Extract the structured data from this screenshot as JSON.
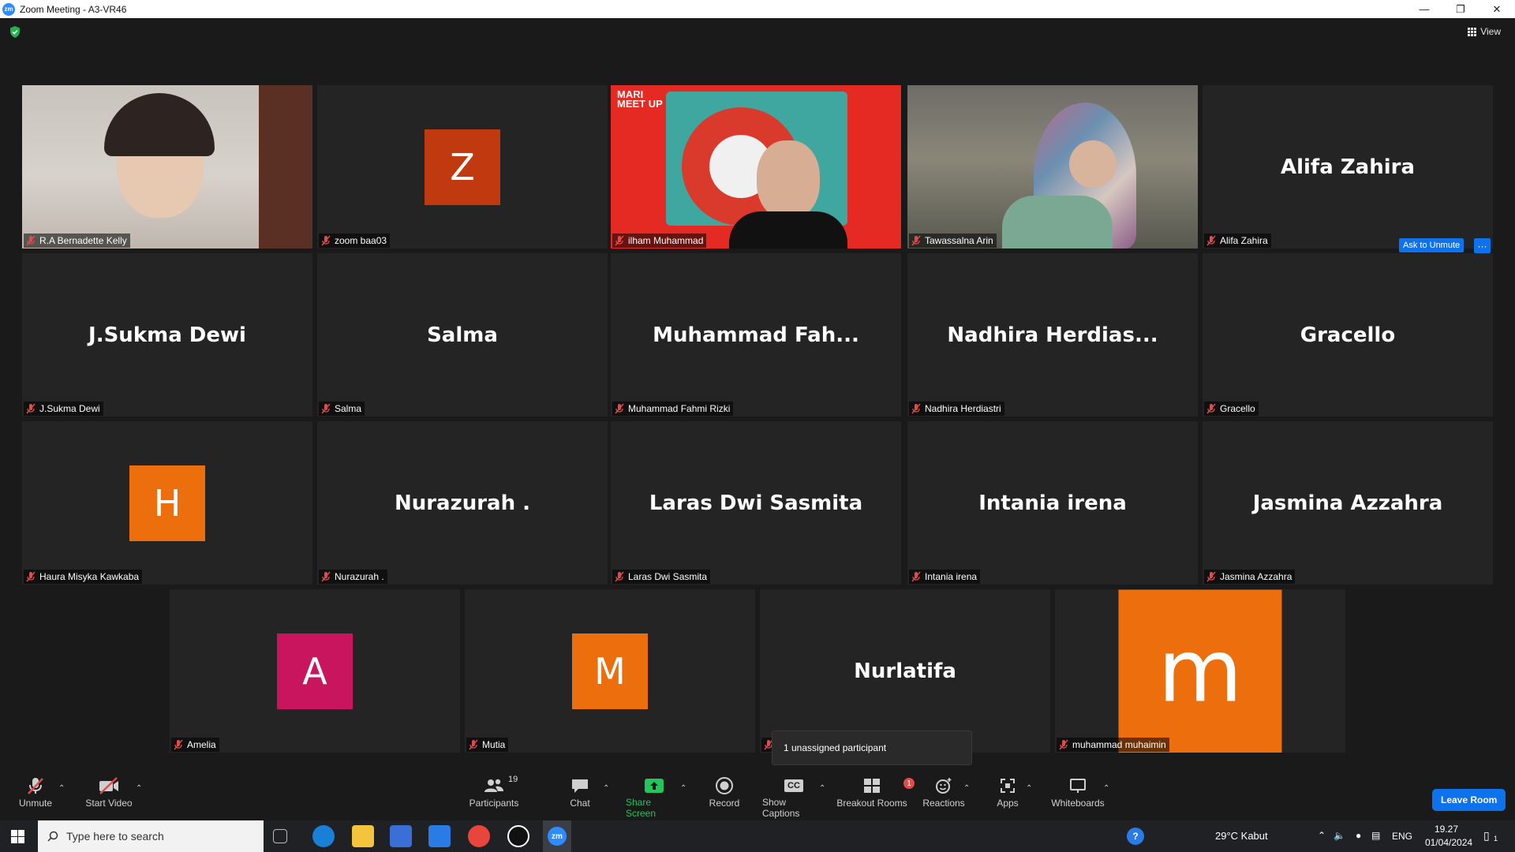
{
  "window": {
    "title": "Zoom Meeting - A3-VR46",
    "app_icon": "zm"
  },
  "meeting": {
    "view_label": "View",
    "ask_to_unmute": "Ask to Unmute",
    "more_glyph": "···",
    "unassigned_text": "1 unassigned participant"
  },
  "tiles": [
    {
      "label": "R.A Bernadette Kelly",
      "type": "video"
    },
    {
      "label": "zoom baa03",
      "initial": "Z",
      "color": "#c0390f"
    },
    {
      "label": "ilham Muhammad",
      "type": "video",
      "active": true
    },
    {
      "label": "Tawassalna Arin",
      "type": "video"
    },
    {
      "label": "Alifa Zahira",
      "display": "Alifa Zahira"
    },
    {
      "label": "J.Sukma Dewi",
      "display": "J.Sukma Dewi"
    },
    {
      "label": "Salma",
      "display": "Salma"
    },
    {
      "label": "Muhammad Fahmi Rizki",
      "display": "Muhammad  Fah..."
    },
    {
      "label": "Nadhira Herdiastri",
      "display": "Nadhira  Herdias..."
    },
    {
      "label": "Gracello",
      "display": "Gracello"
    },
    {
      "label": "Haura Misyka Kawkaba",
      "initial": "H",
      "color": "#ec6e0c"
    },
    {
      "label": "Nurazurah .",
      "display": "Nurazurah ."
    },
    {
      "label": "Laras Dwi Sasmita",
      "display": "Laras Dwi Sasmita"
    },
    {
      "label": "Intania irena",
      "display": "Intania irena"
    },
    {
      "label": "Jasmina Azzahra",
      "display": "Jasmina Azzahra"
    },
    {
      "label": "Amelia",
      "initial": "A",
      "color": "#c8155e"
    },
    {
      "label": "Mutia",
      "initial": "M",
      "color": "#ec6e0c"
    },
    {
      "label": "Nurlatifa",
      "display": "Nurlatifa"
    },
    {
      "label": "muhammad muhaimin",
      "initial": "m",
      "color": "#ec6e0c"
    }
  ],
  "video_overlay": {
    "sign_text": "MARI\nMEET UP"
  },
  "toolbar": {
    "unmute": "Unmute",
    "start_video": "Start Video",
    "participants": "Participants",
    "participants_count": "19",
    "chat": "Chat",
    "share_screen": "Share Screen",
    "record": "Record",
    "show_captions": "Show Captions",
    "captions_glyph": "CC",
    "breakout_rooms": "Breakout Rooms",
    "breakout_badge": "1",
    "reactions": "Reactions",
    "apps": "Apps",
    "whiteboards": "Whiteboards",
    "leave_room": "Leave Room"
  },
  "taskbar": {
    "search_placeholder": "Type here to search",
    "weather": "29°C  Kabut",
    "lang": "ENG",
    "time": "19.27",
    "date": "01/04/2024",
    "zoom_label": "zm",
    "notification_count": "1"
  },
  "colors": {
    "accent": "#0e72ed",
    "active_border": "#f5e55b",
    "share_green": "#22c55e",
    "muted_red": "#e34b4b"
  }
}
